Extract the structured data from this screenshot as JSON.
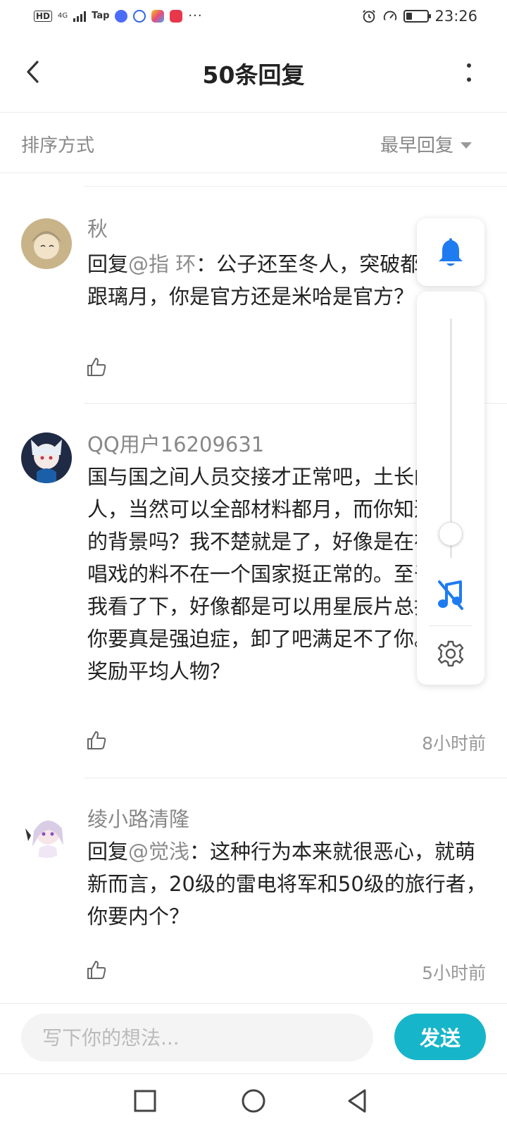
{
  "status_bar": {
    "hd": "HD",
    "network": "4G",
    "tap": "Tap",
    "dots": "···",
    "time": "23:26"
  },
  "header": {
    "title": "50条回复"
  },
  "sort": {
    "label": "排序方式",
    "value": "最早回复"
  },
  "comments": [
    {
      "user": "秋",
      "reply_prefix": "回复",
      "mention": "@指  环",
      "text": "：公子还至冬人，突破都在蒙德跟璃月，你是官方还是米哈是官方？",
      "time": "",
      "avatar_color": "#c9b48a"
    },
    {
      "user": "QQ用户16209631",
      "reply_prefix": "",
      "mention": "",
      "text": "国与国之间人员交接才正常吧，土长的璃月人，当然可以全部材料都月，而你知道云槿的背景吗？我不楚就是了，好像是在在游走唱戏的料不在一个国家挺正常的。至于突料我看了下，好像都是可以用星辰片总换的。你要真是强迫症，卸了吧满足不了你。boss奖励平均人物？",
      "time": "8小时前",
      "avatar_color": "#2b3a55"
    },
    {
      "user": "绫小路清隆",
      "reply_prefix": "回复",
      "mention": "@觉浅",
      "text": "：这种行为本来就很恶心，就萌新而言，20级的雷电将军和50级的旅行者，你要内个？",
      "time": "5小时前",
      "avatar_color": "#e8dff0"
    }
  ],
  "volume": {
    "level": 0.1
  },
  "input": {
    "placeholder": "写下你的想法...",
    "send_label": "发送"
  },
  "colors": {
    "accent": "#17b5c9",
    "icon_blue": "#1e7bf0"
  }
}
